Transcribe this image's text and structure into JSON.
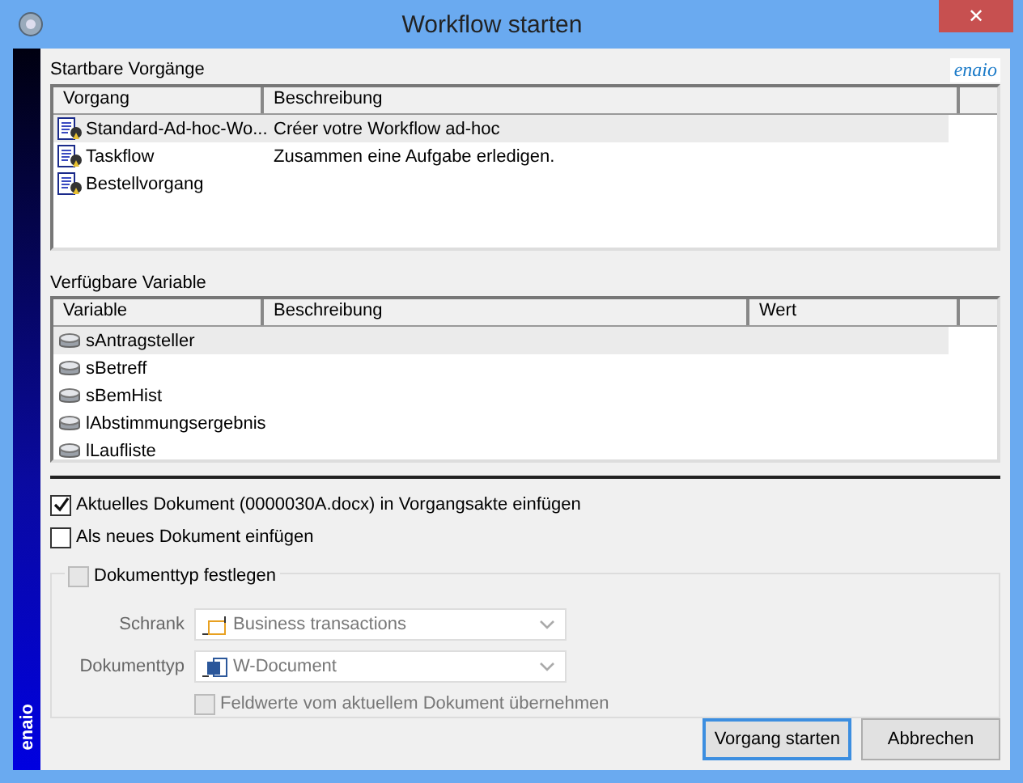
{
  "window": {
    "title": "Workflow starten",
    "close": "✕"
  },
  "side_brand": "enaio",
  "brand_logo": "enaio",
  "processes": {
    "label": "Startbare Vorgänge",
    "columns": [
      "Vorgang",
      "Beschreibung"
    ],
    "rows": [
      {
        "name": "Standard-Ad-hoc-Wo...",
        "description": "Créer votre Workflow ad-hoc",
        "selected": true
      },
      {
        "name": "Taskflow",
        "description": "Zusammen eine Aufgabe erledigen.",
        "selected": false
      },
      {
        "name": "Bestellvorgang",
        "description": "",
        "selected": false
      }
    ]
  },
  "variables": {
    "label": "Verfügbare Variable",
    "columns": [
      "Variable",
      "Beschreibung",
      "Wert"
    ],
    "rows": [
      {
        "name": "sAntragsteller",
        "selected": true
      },
      {
        "name": "sBetreff",
        "selected": false
      },
      {
        "name": "sBemHist",
        "selected": false
      },
      {
        "name": "lAbstimmungsergebnis",
        "selected": false
      },
      {
        "name": "lLaufliste",
        "selected": false
      }
    ]
  },
  "options": [
    {
      "label": "Aktuelles Dokument (0000030A.docx) in Vorgangsakte einfügen",
      "checked": true,
      "disabled": false
    },
    {
      "label": "Als neues Dokument einfügen",
      "checked": false,
      "disabled": false
    }
  ],
  "doctype_group": {
    "label": "Dokumenttyp festlegen",
    "checked": false,
    "disabled": true,
    "fields": [
      {
        "label": "Schrank",
        "value": "Business transactions",
        "kind": "cabinet"
      },
      {
        "label": "Dokumenttyp",
        "value": "W-Document",
        "kind": "word"
      }
    ],
    "copy_fields": {
      "label": "Feldwerte vom aktuellem Dokument übernehmen",
      "checked": false,
      "disabled": true
    }
  },
  "buttons": [
    {
      "label": "Vorgang starten",
      "default": true
    },
    {
      "label": "Abbrechen",
      "default": false
    }
  ]
}
